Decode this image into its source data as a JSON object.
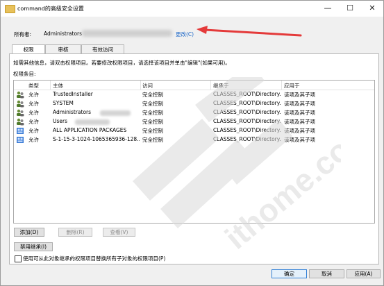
{
  "window": {
    "title": "command的高级安全设置",
    "minimize_glyph": "—",
    "maximize_glyph": "☐",
    "close_glyph": "✕"
  },
  "owner": {
    "label": "所有者:",
    "name": "Administrators",
    "change_link": "更改(C)"
  },
  "tabs": [
    "权限",
    "审核",
    "有效访问"
  ],
  "info_text": "如需其他信息，请双击权限项目。若要修改权限项目，请选择该项目并单击\"编辑\"(如果可用)。",
  "entries_label": "权限条目:",
  "columns": [
    "类型",
    "主体",
    "访问",
    "继承于",
    "应用于"
  ],
  "entries": [
    {
      "icon": "users-icon",
      "type": "允许",
      "principal": "TrustedInstaller",
      "access": "完全控制",
      "inherited": "CLASSES_ROOT\\Directory...",
      "applies": "该项及其子项"
    },
    {
      "icon": "users-icon",
      "type": "允许",
      "principal": "SYSTEM",
      "access": "完全控制",
      "inherited": "CLASSES_ROOT\\Directory...",
      "applies": "该项及其子项"
    },
    {
      "icon": "users-icon",
      "type": "允许",
      "principal": "Administrators",
      "access": "完全控制",
      "inherited": "CLASSES_ROOT\\Directory...",
      "applies": "该项及其子项"
    },
    {
      "icon": "users-icon",
      "type": "允许",
      "principal": "Users",
      "access": "完全控制",
      "inherited": "CLASSES_ROOT\\Directory...",
      "applies": "该项及其子项"
    },
    {
      "icon": "package-icon",
      "type": "允许",
      "principal": "ALL APPLICATION PACKAGES",
      "access": "完全控制",
      "inherited": "CLASSES_ROOT\\Directory...",
      "applies": "该项及其子项"
    },
    {
      "icon": "package-icon",
      "type": "允许",
      "principal": "S-1-15-3-1024-1065365936-128...",
      "access": "完全控制",
      "inherited": "CLASSES_ROOT\\Directory...",
      "applies": "该项及其子项"
    }
  ],
  "buttons": {
    "add": "添加(D)",
    "remove": "删除(R)",
    "view": "查看(V)",
    "disable_inheritance": "禁用继承(I)",
    "ok": "确定",
    "cancel": "取消",
    "apply": "应用(A)"
  },
  "replace_checkbox_label": "使用可从此对象继承的权限项目替换所有子对象的权限项目(P)",
  "replace_checkbox_checked": false,
  "colors": {
    "link": "#1a66c8",
    "arrow": "#e43a3a",
    "folder": "#e8c15a",
    "watermark": "#d9d9d9"
  }
}
